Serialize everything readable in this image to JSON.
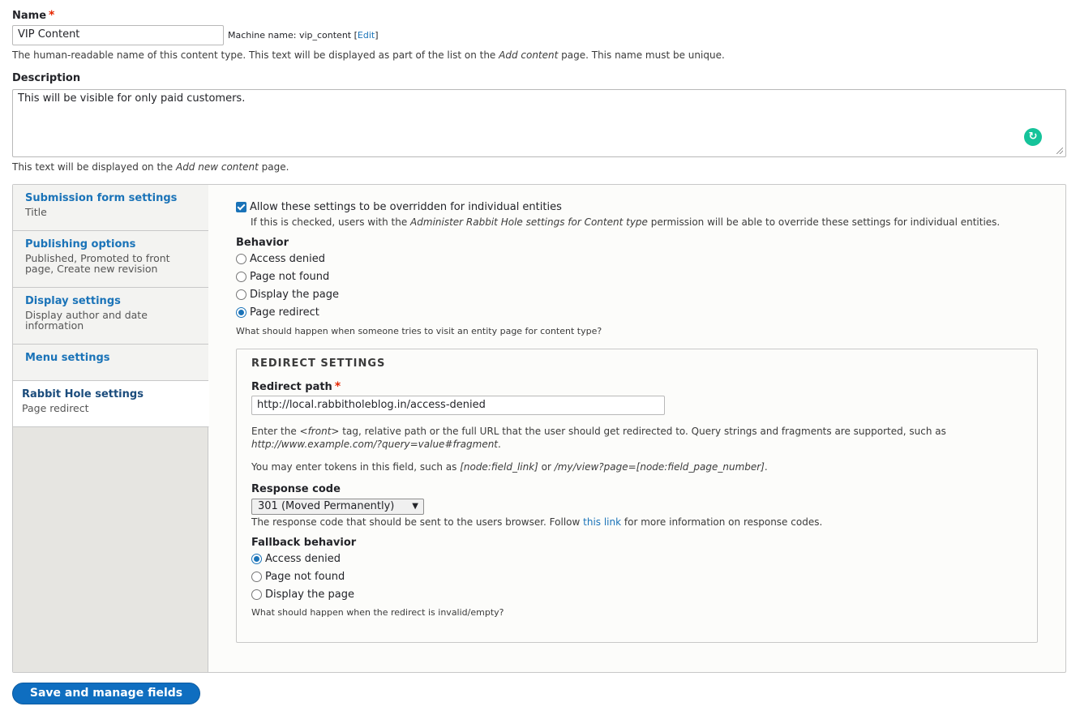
{
  "name_field": {
    "label": "Name",
    "required_mark": "*",
    "value": "VIP Content",
    "machine_name_prefix": "Machine name: vip_content",
    "edit_link": "Edit",
    "desc_before": "The human-readable name of this content type. This text will be displayed as part of the list on the ",
    "desc_em": "Add content",
    "desc_after": " page. This name must be unique."
  },
  "description_field": {
    "label": "Description",
    "value": "This will be visible for only paid customers.",
    "desc_before": "This text will be displayed on the ",
    "desc_em": "Add new content",
    "desc_after": " page."
  },
  "vertical_tabs": [
    {
      "title": "Submission form settings",
      "summary": "Title"
    },
    {
      "title": "Publishing options",
      "summary": "Published, Promoted to front page, Create new revision"
    },
    {
      "title": "Display settings",
      "summary": "Display author and date information"
    },
    {
      "title": "Menu settings",
      "summary": ""
    },
    {
      "title": "Rabbit Hole settings",
      "summary": "Page redirect"
    }
  ],
  "rabbit_hole": {
    "override_label": "Allow these settings to be overridden for individual entities",
    "override_desc_before": "If this is checked, users with the ",
    "override_desc_em": "Administer Rabbit Hole settings for Content type",
    "override_desc_after": " permission will be able to override these settings for individual entities.",
    "behavior_label": "Behavior",
    "behavior_options": [
      "Access denied",
      "Page not found",
      "Display the page",
      "Page redirect"
    ],
    "behavior_selected": "Page redirect",
    "behavior_desc": "What should happen when someone tries to visit an entity page for content type?",
    "redirect": {
      "legend": "Redirect settings",
      "path_label": "Redirect path",
      "required_mark": "*",
      "path_value": "http://local.rabbitholeblog.in/access-denied",
      "path_desc_1a": "Enter the ",
      "path_desc_1em": "<front>",
      "path_desc_1b": " tag, relative path or the full URL that the user should get redirected to. Query strings and fragments are supported, such as",
      "path_desc_2em": "http://www.example.com/?query=value#fragment",
      "path_desc_2b": ".",
      "tokens_a": "You may enter tokens in this field, such as ",
      "tokens_em1": "[node:field_link]",
      "tokens_b": " or ",
      "tokens_em2": "/my/view?page=[node:field_page_number]",
      "tokens_c": ".",
      "response_label": "Response code",
      "response_value": "301 (Moved Permanently)",
      "response_desc_a": "The response code that should be sent to the users browser. Follow ",
      "response_link": "this link",
      "response_desc_b": " for more information on response codes.",
      "fallback_label": "Fallback behavior",
      "fallback_options": [
        "Access denied",
        "Page not found",
        "Display the page"
      ],
      "fallback_selected": "Access denied",
      "fallback_desc": "What should happen when the redirect is invalid/empty?"
    }
  },
  "save_button": "Save and manage fields",
  "colors": {
    "accent": "#1a73b8",
    "button": "#0f6ec0",
    "required": "#e62600",
    "grammarly": "#15c39a"
  }
}
